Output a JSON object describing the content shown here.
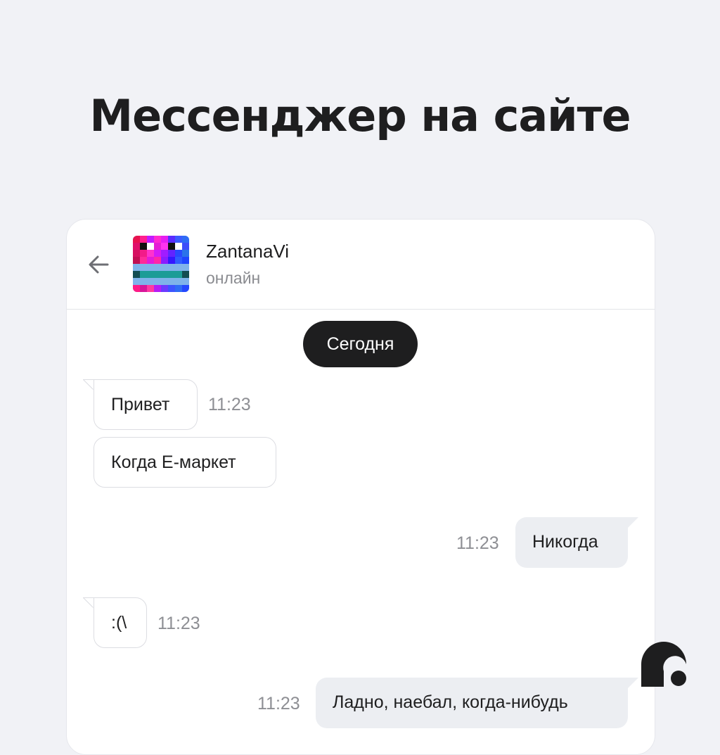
{
  "headline": "Мессенджер на сайте",
  "header": {
    "back_icon": "arrow-left-icon",
    "contact_name": "ZantanaVi",
    "contact_status": "онлайн"
  },
  "date_separator": "Сегодня",
  "messages": [
    {
      "direction": "incoming",
      "text": "Привет",
      "time": "11:23"
    },
    {
      "direction": "incoming",
      "text": "Когда Е-маркет",
      "time": ""
    },
    {
      "direction": "outgoing",
      "text": "Никогда",
      "time": "11:23"
    },
    {
      "direction": "incoming",
      "text": ":(\\",
      "time": "11:23"
    },
    {
      "direction": "outgoing",
      "text": "Ладно, наебал, когда-нибудь",
      "time": "11:23"
    }
  ],
  "colors": {
    "page_background": "#f1f2f6",
    "card_background": "#ffffff",
    "dark": "#1e1e1f",
    "outgoing_bubble": "#eceef2",
    "muted_text": "#8e8f94"
  }
}
